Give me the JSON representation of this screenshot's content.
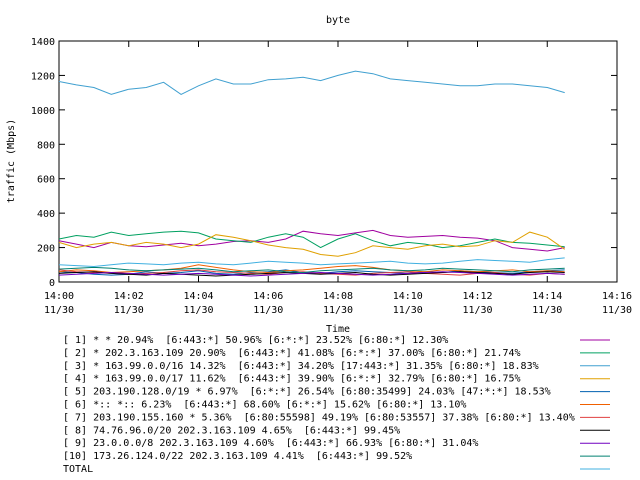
{
  "chart_data": {
    "type": "line",
    "title": "byte",
    "xlabel": "Time",
    "ylabel": "traffic (Mbps)",
    "ylim": [
      0,
      1400
    ],
    "yticks": [
      0,
      200,
      400,
      600,
      800,
      1000,
      1200,
      1400
    ],
    "xlim_minutes": [
      0,
      16
    ],
    "xticks": [
      {
        "minute": 0,
        "time": "14:00",
        "date": "11/30"
      },
      {
        "minute": 2,
        "time": "14:02",
        "date": "11/30"
      },
      {
        "minute": 4,
        "time": "14:04",
        "date": "11/30"
      },
      {
        "minute": 6,
        "time": "14:06",
        "date": "11/30"
      },
      {
        "minute": 8,
        "time": "14:08",
        "date": "11/30"
      },
      {
        "minute": 10,
        "time": "14:10",
        "date": "11/30"
      },
      {
        "minute": 12,
        "time": "14:12",
        "date": "11/30"
      },
      {
        "minute": 14,
        "time": "14:14",
        "date": "11/30"
      },
      {
        "minute": 16,
        "time": "14:16",
        "date": "11/30"
      }
    ],
    "grid": false,
    "legend_position": "bottom",
    "x_minutes": [
      0,
      0.5,
      1,
      1.5,
      2,
      2.5,
      3,
      3.5,
      4,
      4.5,
      5,
      5.5,
      6,
      6.5,
      7,
      7.5,
      8,
      8.5,
      9,
      9.5,
      10,
      10.5,
      11,
      11.5,
      12,
      12.5,
      13,
      13.5,
      14,
      14.5
    ],
    "series": [
      {
        "name": "[ 1] * * 20.94%  [6:443:*] 50.96% [6:*:*] 23.52% [6:80:*] 12.30%",
        "color": "#a000a0",
        "values": [
          240,
          220,
          200,
          230,
          210,
          205,
          215,
          225,
          210,
          220,
          235,
          240,
          230,
          250,
          295,
          280,
          270,
          285,
          300,
          270,
          260,
          265,
          270,
          260,
          255,
          240,
          200,
          190,
          180,
          200
        ]
      },
      {
        "name": "[ 2] * 202.3.163.109 20.90%  [6:443:*] 41.08% [6:*:*] 37.00% [6:80:*] 21.74%",
        "color": "#00a060",
        "values": [
          250,
          270,
          260,
          290,
          270,
          280,
          290,
          295,
          285,
          250,
          240,
          230,
          260,
          280,
          260,
          200,
          250,
          280,
          240,
          210,
          230,
          220,
          200,
          210,
          230,
          250,
          230,
          225,
          215,
          205
        ]
      },
      {
        "name": "[ 3] * 163.99.0.0/16 14.32%  [6:443:*] 34.20% [17:443:*] 31.35% [6:80:*] 18.83%",
        "color": "#40a0d0",
        "values": [
          1165,
          1145,
          1130,
          1090,
          1120,
          1130,
          1160,
          1090,
          1140,
          1180,
          1150,
          1150,
          1175,
          1180,
          1190,
          1170,
          1200,
          1225,
          1210,
          1180,
          1170,
          1160,
          1150,
          1140,
          1140,
          1150,
          1150,
          1140,
          1130,
          1100
        ]
      },
      {
        "name": "[ 4] * 163.99.0.0/17 11.62%  [6:443:*] 39.90% [6:*:*] 32.79% [6:80:*] 16.75%",
        "color": "#e0a000",
        "values": [
          230,
          200,
          220,
          230,
          210,
          230,
          220,
          200,
          220,
          275,
          260,
          240,
          215,
          200,
          190,
          160,
          150,
          170,
          210,
          200,
          190,
          210,
          220,
          205,
          210,
          240,
          230,
          290,
          260,
          190
        ]
      },
      {
        "name": "[ 5] 203.190.128.0/19 * 6.97%  [6:*:*] 26.54% [6:80:35499] 24.03% [47:*:*] 18.53%",
        "color": "#0060b0",
        "values": [
          60,
          55,
          45,
          40,
          45,
          60,
          50,
          55,
          65,
          50,
          45,
          55,
          60,
          70,
          55,
          50,
          60,
          65,
          60,
          55,
          50,
          60,
          55,
          65,
          60,
          55,
          50,
          60,
          65,
          70
        ]
      },
      {
        "name": "[ 6] *:: *:: 6.23%  [6:443:*] 68.60% [6:*:*] 15.62% [6:80:*] 13.10%",
        "color": "#f06000",
        "values": [
          60,
          70,
          65,
          55,
          60,
          65,
          70,
          80,
          100,
          85,
          70,
          60,
          55,
          65,
          70,
          80,
          90,
          95,
          85,
          70,
          65,
          60,
          70,
          65,
          60,
          65,
          70,
          60,
          65,
          60
        ]
      },
      {
        "name": "[ 7] 203.190.155.160 * 5.36%  [6:80:55598] 49.19% [6:80:53557] 37.38% [6:80:*] 13.40%",
        "color": "#e04040",
        "values": [
          70,
          60,
          55,
          50,
          45,
          50,
          55,
          65,
          70,
          60,
          55,
          50,
          45,
          55,
          60,
          50,
          45,
          40,
          50,
          55,
          60,
          50,
          45,
          40,
          50,
          55,
          45,
          40,
          50,
          45
        ]
      },
      {
        "name": "[ 8] 74.76.96.0/20 202.3.163.109 4.65%  [6:443:*] 99.45%",
        "color": "#000000",
        "values": [
          50,
          55,
          60,
          50,
          45,
          40,
          50,
          45,
          40,
          35,
          40,
          45,
          50,
          55,
          50,
          45,
          50,
          55,
          45,
          40,
          45,
          50,
          55,
          60,
          55,
          50,
          45,
          55,
          60,
          55
        ]
      },
      {
        "name": "[ 9] 23.0.0.0/8 202.3.163.109 4.60%  [6:443:*] 66.93% [6:80:*] 31.04%",
        "color": "#7000c0",
        "values": [
          40,
          45,
          50,
          55,
          50,
          45,
          40,
          45,
          50,
          45,
          40,
          35,
          40,
          45,
          50,
          55,
          50,
          45,
          40,
          45,
          50,
          55,
          60,
          55,
          50,
          45,
          40,
          45,
          50,
          45
        ]
      },
      {
        "name": "[10] 173.26.124.0/22 202.3.163.109 4.41%  [6:443:*] 99.52%",
        "color": "#008070",
        "values": [
          75,
          80,
          85,
          80,
          70,
          65,
          70,
          75,
          80,
          70,
          60,
          65,
          70,
          60,
          55,
          65,
          70,
          75,
          80,
          70,
          65,
          70,
          80,
          75,
          70,
          65,
          60,
          70,
          75,
          80
        ]
      },
      {
        "name": "TOTAL",
        "color": "#40b0e0",
        "values": [
          100,
          95,
          90,
          100,
          110,
          105,
          100,
          110,
          115,
          105,
          100,
          110,
          120,
          115,
          110,
          100,
          105,
          110,
          115,
          120,
          110,
          105,
          110,
          120,
          130,
          125,
          120,
          115,
          130,
          140
        ]
      }
    ]
  }
}
